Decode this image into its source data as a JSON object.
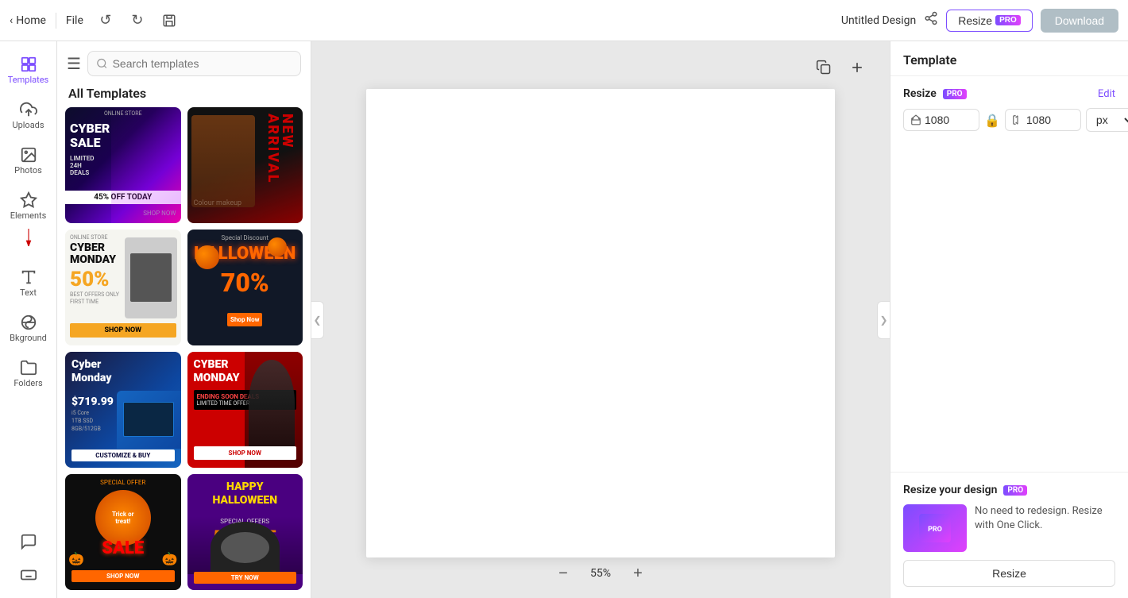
{
  "topbar": {
    "home_label": "Home",
    "file_label": "File",
    "design_title": "Untitled Design",
    "resize_label": "Resize",
    "pro_badge": "PRO",
    "download_label": "Download"
  },
  "sidebar": {
    "items": [
      {
        "id": "templates",
        "label": "Templates",
        "active": true
      },
      {
        "id": "uploads",
        "label": "Uploads",
        "active": false
      },
      {
        "id": "photos",
        "label": "Photos",
        "active": false
      },
      {
        "id": "elements",
        "label": "Elements",
        "active": false
      },
      {
        "id": "text",
        "label": "Text",
        "active": false
      },
      {
        "id": "background",
        "label": "Bkground",
        "active": false
      },
      {
        "id": "folders",
        "label": "Folders",
        "active": false
      },
      {
        "id": "chat",
        "label": "Chat",
        "active": false
      },
      {
        "id": "keyboard",
        "label": "Keyboard",
        "active": false
      }
    ]
  },
  "templates_panel": {
    "search_placeholder": "Search templates",
    "title": "All Templates",
    "cards": [
      {
        "id": "cyber-sale",
        "label": "Cyber Sale"
      },
      {
        "id": "new-arrival",
        "label": "New Arrival"
      },
      {
        "id": "cyber-monday-white",
        "label": "Cyber Monday"
      },
      {
        "id": "halloween-70",
        "label": "Halloween 70%"
      },
      {
        "id": "cyber-laptop",
        "label": "Cyber Monday"
      },
      {
        "id": "cyber-monday-red",
        "label": "Cyber Monday Red"
      },
      {
        "id": "halloween-trick",
        "label": "Trick or Treat"
      },
      {
        "id": "happy-halloween",
        "label": "Happy Halloween"
      }
    ]
  },
  "right_panel": {
    "title": "Template",
    "resize_label": "Resize",
    "pro_badge": "PRO",
    "edit_label": "Edit",
    "width_value": "1080",
    "height_value": "1080",
    "unit": "px",
    "promo_title": "Resize your design",
    "promo_badge": "PRO",
    "promo_desc": "No need to redesign. Resize with One Click.",
    "resize_btn_label": "Resize"
  },
  "canvas": {
    "zoom": "55%"
  }
}
